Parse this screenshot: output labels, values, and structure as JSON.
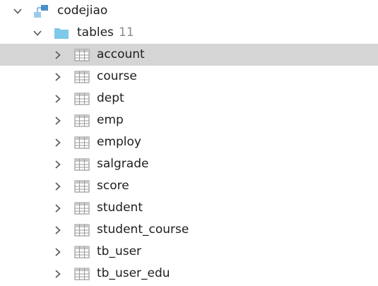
{
  "tree": {
    "database": {
      "name": "codejiao",
      "icon": "database-schema-icon",
      "expanded": true
    },
    "folder": {
      "name": "tables",
      "count": "11",
      "icon": "folder-icon",
      "expanded": true
    },
    "tables": [
      {
        "name": "account",
        "icon": "table-icon",
        "selected": true
      },
      {
        "name": "course",
        "icon": "table-icon",
        "selected": false
      },
      {
        "name": "dept",
        "icon": "table-icon",
        "selected": false
      },
      {
        "name": "emp",
        "icon": "table-icon",
        "selected": false
      },
      {
        "name": "employ",
        "icon": "table-icon",
        "selected": false
      },
      {
        "name": "salgrade",
        "icon": "table-icon",
        "selected": false
      },
      {
        "name": "score",
        "icon": "table-icon",
        "selected": false
      },
      {
        "name": "student",
        "icon": "table-icon",
        "selected": false
      },
      {
        "name": "student_course",
        "icon": "table-icon",
        "selected": false
      },
      {
        "name": "tb_user",
        "icon": "table-icon",
        "selected": false
      },
      {
        "name": "tb_user_edu",
        "icon": "table-icon",
        "selected": false
      }
    ]
  },
  "colors": {
    "selection": "#d5d5d5",
    "folder": "#7ec8e8",
    "schema": "#4a90c8",
    "table_icon": "#9a9a9a"
  }
}
